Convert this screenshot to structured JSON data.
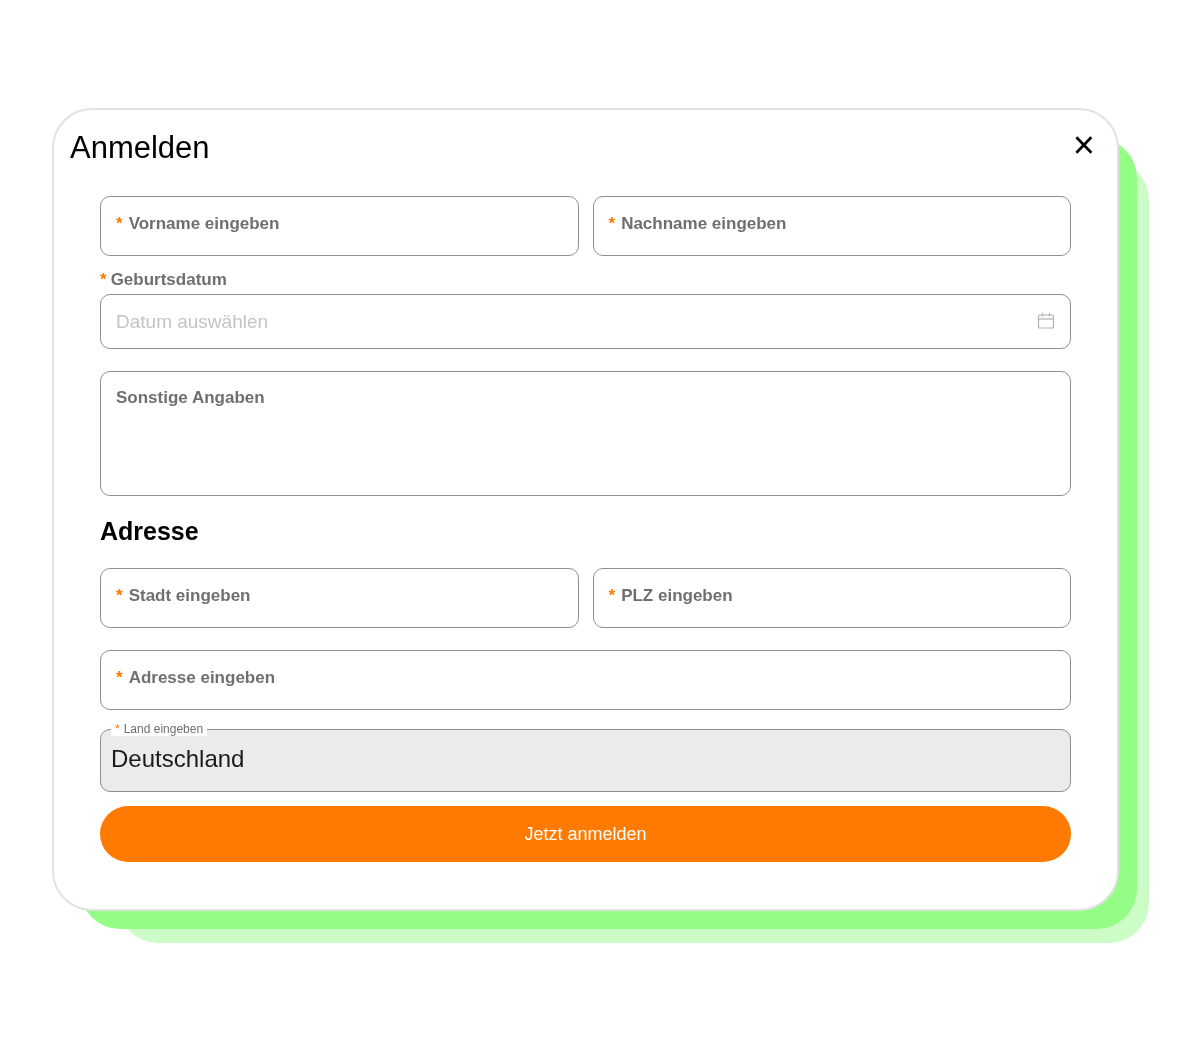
{
  "dialog": {
    "title": "Anmelden",
    "close": "×"
  },
  "rows": [
    [
      {
        "kind": "text",
        "label": "Vorname eingeben",
        "required_mark": "*"
      },
      {
        "kind": "text",
        "label": "Nachname eingeben",
        "required_mark": "*"
      }
    ],
    [
      {
        "kind": "date",
        "label": "Geburtsdatum",
        "required_mark": "*",
        "placeholder": "Datum auswählen"
      }
    ],
    [
      {
        "kind": "textarea",
        "label": "Sonstige Angaben"
      }
    ],
    [
      {
        "kind": "heading",
        "label": "Adresse"
      }
    ],
    [
      {
        "kind": "text",
        "label": "Stadt eingeben",
        "required_mark": "*"
      },
      {
        "kind": "text",
        "label": "PLZ eingeben",
        "required_mark": "*"
      }
    ],
    [
      {
        "kind": "text",
        "label": "Adresse eingeben",
        "required_mark": "*"
      }
    ],
    [
      {
        "kind": "filled",
        "label": "Land eingeben",
        "required_mark": "*",
        "value": "Deutschland"
      }
    ]
  ],
  "submit": {
    "label": "Jetzt anmelden"
  }
}
